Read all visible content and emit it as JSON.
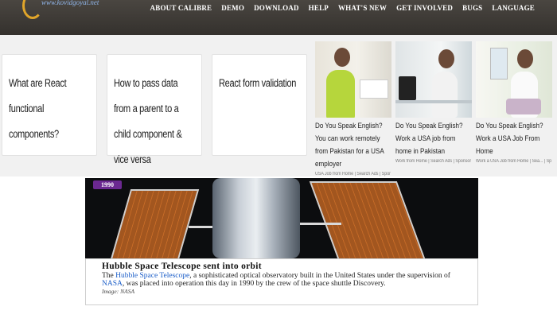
{
  "nav": {
    "logo_text": "www.kovidgoyal.net",
    "items": [
      "About Calibre",
      "Demo",
      "Download",
      "Help",
      "What's New",
      "Get Involved",
      "Bugs",
      "Language"
    ]
  },
  "cards": [
    "What are React functional components?",
    "How to pass data from a parent to a child component & vice versa",
    "React form validation"
  ],
  "ads": [
    {
      "title": "Do You Speak English? You can work remotely from Pakistan for a USA employer",
      "meta": "USA Job from Home | Search Ads | Sponsored"
    },
    {
      "title": "Do You Speak English? Work a USA job from home in Pakistan",
      "meta": "Work from Home | Search Ads | Sponsored"
    },
    {
      "title": "Do You Speak English? Work a USA Job From Home",
      "meta": "Work a USA Job from Home | Sea... | Sponsored"
    }
  ],
  "hubble": {
    "year": "1990",
    "title": "Hubble Space Telescope sent into orbit",
    "body_1": "The ",
    "link_1": "Hubble Space Telescope",
    "body_2": ", a sophisticated optical observatory built in the United States under the supervision of ",
    "link_2": "NASA",
    "body_3": ", was placed into operation this day in 1990 by the crew of the space shuttle Discovery.",
    "credit": "Image: NASA"
  },
  "colors": {
    "nav_bg": "#3d3a36",
    "badge": "#6b2891",
    "link": "#1a5dc8",
    "solar_panel": "#b05f22"
  }
}
